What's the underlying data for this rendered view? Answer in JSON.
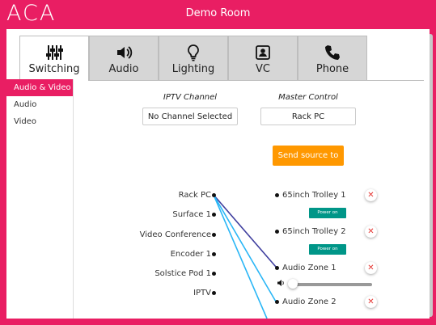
{
  "header": {
    "logo": "ACA",
    "room_title": "Demo Room",
    "brand_color": "#e91e63"
  },
  "tabs": [
    {
      "label": "Switching",
      "icon": "sliders-icon",
      "active": true
    },
    {
      "label": "Audio",
      "icon": "speaker-icon",
      "active": false
    },
    {
      "label": "Lighting",
      "icon": "lightbulb-icon",
      "active": false
    },
    {
      "label": "VC",
      "icon": "vc-icon",
      "active": false
    },
    {
      "label": "Phone",
      "icon": "phone-icon",
      "active": false
    }
  ],
  "sidebar": {
    "items": [
      {
        "label": "Audio & Video",
        "active": true
      },
      {
        "label": "Audio",
        "active": false
      },
      {
        "label": "Video",
        "active": false
      }
    ]
  },
  "iptv": {
    "header": "IPTV Channel",
    "value": "No Channel Selected"
  },
  "master": {
    "header": "Master Control",
    "value": "Rack PC"
  },
  "send_button": "Send source to all",
  "sources": [
    "Rack PC",
    "Surface 1",
    "Video Conference",
    "Encoder 1",
    "Solstice Pod 1",
    "IPTV"
  ],
  "destinations": [
    {
      "label": "65inch Trolley 1",
      "power": "Power on"
    },
    {
      "label": "65inch Trolley 2",
      "power": "Power on"
    },
    {
      "label": "Audio Zone 1"
    },
    {
      "label": "Audio Zone 2"
    }
  ],
  "remove_symbol": "✕",
  "audio_zone_1_volume": 0.02,
  "route_colors": {
    "dark": "#3f3f9f",
    "light": "#29b6f6"
  }
}
